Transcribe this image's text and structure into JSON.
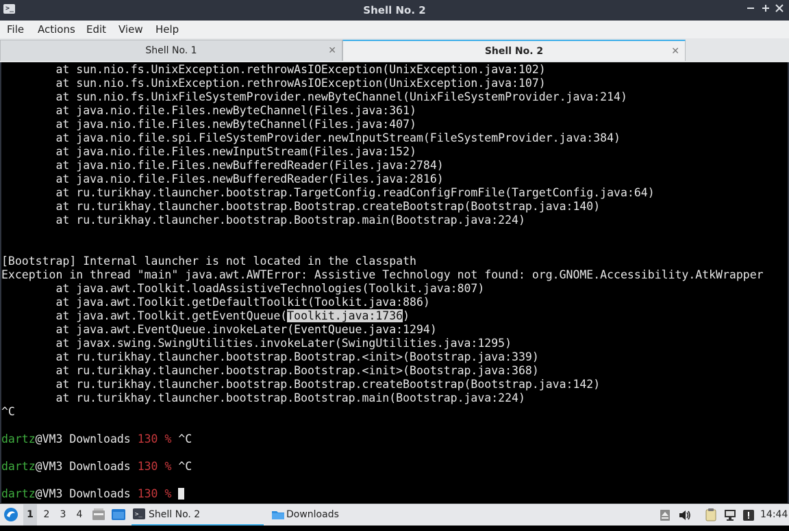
{
  "window": {
    "title": "Shell No. 2",
    "app_icon": "terminal-icon",
    "buttons": [
      "minimize",
      "maximize",
      "close"
    ]
  },
  "menu": [
    "File",
    "Actions",
    "Edit",
    "View",
    "Help"
  ],
  "tabs": [
    {
      "label": "Shell No. 1",
      "active": false
    },
    {
      "label": "Shell No. 2",
      "active": true
    }
  ],
  "terminal": {
    "lines": [
      "        at sun.nio.fs.UnixException.rethrowAsIOException(UnixException.java:102)",
      "        at sun.nio.fs.UnixException.rethrowAsIOException(UnixException.java:107)",
      "        at sun.nio.fs.UnixFileSystemProvider.newByteChannel(UnixFileSystemProvider.java:214)",
      "        at java.nio.file.Files.newByteChannel(Files.java:361)",
      "        at java.nio.file.Files.newByteChannel(Files.java:407)",
      "        at java.nio.file.spi.FileSystemProvider.newInputStream(FileSystemProvider.java:384)",
      "        at java.nio.file.Files.newInputStream(Files.java:152)",
      "        at java.nio.file.Files.newBufferedReader(Files.java:2784)",
      "        at java.nio.file.Files.newBufferedReader(Files.java:2816)",
      "        at ru.turikhay.tlauncher.bootstrap.TargetConfig.readConfigFromFile(TargetConfig.java:64)",
      "        at ru.turikhay.tlauncher.bootstrap.Bootstrap.createBootstrap(Bootstrap.java:140)",
      "        at ru.turikhay.tlauncher.bootstrap.Bootstrap.main(Bootstrap.java:224)",
      "",
      "",
      "[Bootstrap] Internal launcher is not located in the classpath",
      "Exception in thread \"main\" java.awt.AWTError: Assistive Technology not found: org.GNOME.Accessibility.AtkWrapper",
      "        at java.awt.Toolkit.loadAssistiveTechnologies(Toolkit.java:807)",
      "        at java.awt.Toolkit.getDefaultToolkit(Toolkit.java:886)",
      "",
      "        at java.awt.EventQueue.invokeLater(EventQueue.java:1294)",
      "        at javax.swing.SwingUtilities.invokeLater(SwingUtilities.java:1295)",
      "        at ru.turikhay.tlauncher.bootstrap.Bootstrap.<init>(Bootstrap.java:339)",
      "        at ru.turikhay.tlauncher.bootstrap.Bootstrap.<init>(Bootstrap.java:368)",
      "        at ru.turikhay.tlauncher.bootstrap.Bootstrap.createBootstrap(Bootstrap.java:142)",
      "        at ru.turikhay.tlauncher.bootstrap.Bootstrap.main(Bootstrap.java:224)",
      "^C"
    ],
    "highlight_line": {
      "prefix": "        at java.awt.Toolkit.getEventQueue(",
      "selected": "Toolkit.java:1736",
      "suffix": ")"
    },
    "prompts": [
      {
        "user": "dartz",
        "host_path": "@VM3 Downloads ",
        "status": "130",
        "symbol": "%",
        "input": "^C"
      },
      {
        "user": "dartz",
        "host_path": "@VM3 Downloads ",
        "status": "130",
        "symbol": "%",
        "input": "^C"
      },
      {
        "user": "dartz",
        "host_path": "@VM3 Downloads ",
        "status": "130",
        "symbol": "%",
        "input": ""
      }
    ]
  },
  "taskbar": {
    "start_icon": "lxqt-menu-icon",
    "desktops": [
      "1",
      "2",
      "3",
      "4"
    ],
    "active_desktop": "1",
    "quicklaunch_icons": [
      "show-desktop-icon",
      "window-icon"
    ],
    "tasks": [
      {
        "label": "Shell No. 2",
        "icon": "terminal-icon",
        "active": true
      },
      {
        "label": "Downloads",
        "icon": "folder-icon",
        "active": false
      }
    ],
    "tray_icons": [
      "eject-icon",
      "volume-icon",
      "clipboard-icon",
      "network-icon",
      "notification-icon"
    ],
    "clock": "14:44"
  },
  "colors": {
    "prompt_user": "#3fae3f",
    "prompt_status": "#c8383c",
    "accent": "#3daee9",
    "titlebar": "#2f343f"
  }
}
